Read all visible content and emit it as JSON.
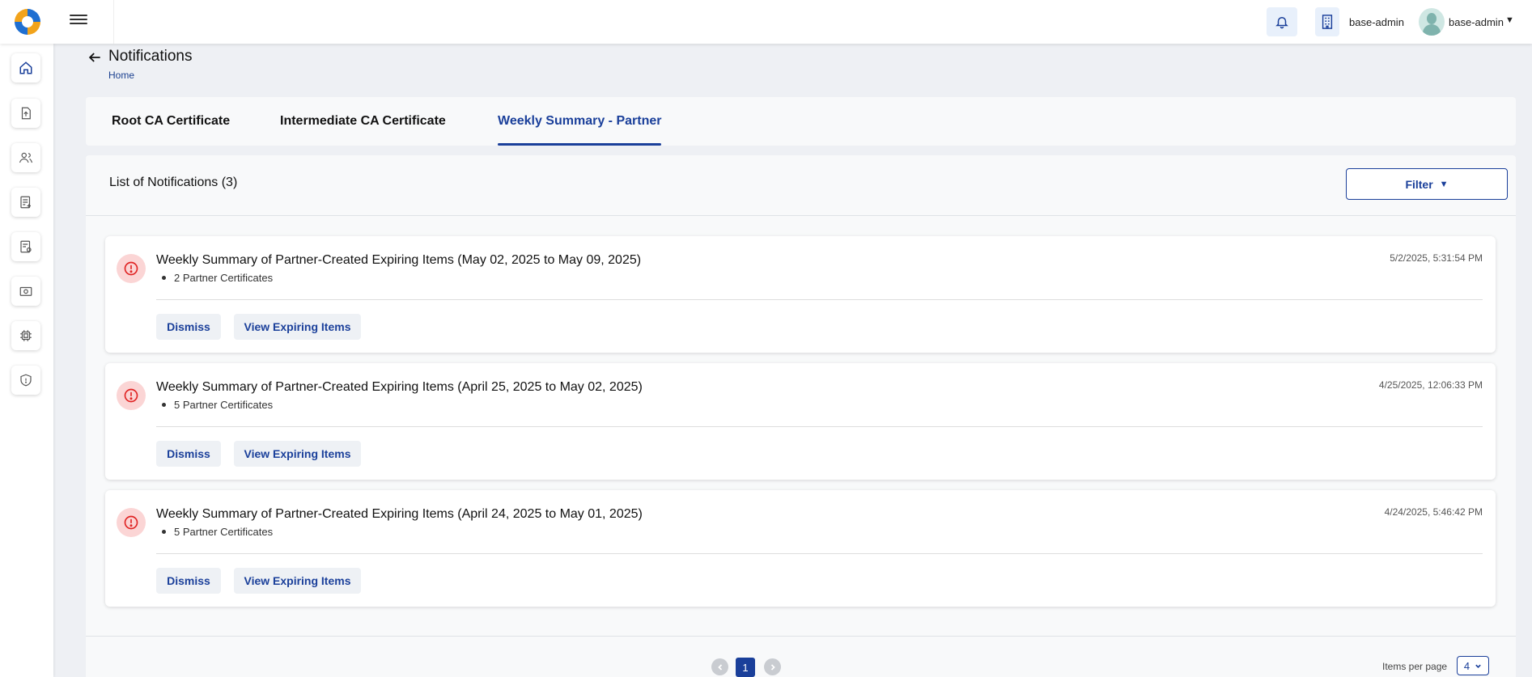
{
  "topbar": {
    "org_name": "base-admin",
    "user_name": "base-admin"
  },
  "sidebar": {
    "items": [
      {
        "icon": "home-icon"
      },
      {
        "icon": "upload-icon"
      },
      {
        "icon": "users-icon"
      },
      {
        "icon": "request-add-icon"
      },
      {
        "icon": "document-settings-icon"
      },
      {
        "icon": "camera-icon"
      },
      {
        "icon": "chip-icon"
      },
      {
        "icon": "shield-icon"
      }
    ]
  },
  "header": {
    "title": "Notifications",
    "breadcrumb": "Home"
  },
  "tabs": [
    {
      "label": "Root CA Certificate"
    },
    {
      "label": "Intermediate CA Certificate"
    },
    {
      "label": "Weekly Summary - Partner",
      "active": true
    }
  ],
  "list": {
    "title": "List of Notifications (3)",
    "filter_label": "Filter"
  },
  "notifications": [
    {
      "title": "Weekly Summary of Partner-Created Expiring Items (May 02, 2025 to May 09, 2025)",
      "detail": "2 Partner Certificates",
      "timestamp": "5/2/2025, 5:31:54 PM",
      "dismiss": "Dismiss",
      "view": "View Expiring Items"
    },
    {
      "title": "Weekly Summary of Partner-Created Expiring Items (April 25, 2025 to May 02, 2025)",
      "detail": "5 Partner Certificates",
      "timestamp": "4/25/2025, 12:06:33 PM",
      "dismiss": "Dismiss",
      "view": "View Expiring Items"
    },
    {
      "title": "Weekly Summary of Partner-Created Expiring Items (April 24, 2025 to May 01, 2025)",
      "detail": "5 Partner Certificates",
      "timestamp": "4/24/2025, 5:46:42 PM",
      "dismiss": "Dismiss",
      "view": "View Expiring Items"
    }
  ],
  "pagination": {
    "current_page": "1",
    "items_per_page_label": "Items per page",
    "items_per_page": "4"
  },
  "colors": {
    "accent": "#1a3f9a",
    "alert_bg": "#fbd5d5",
    "alert_icon": "#e02424"
  }
}
